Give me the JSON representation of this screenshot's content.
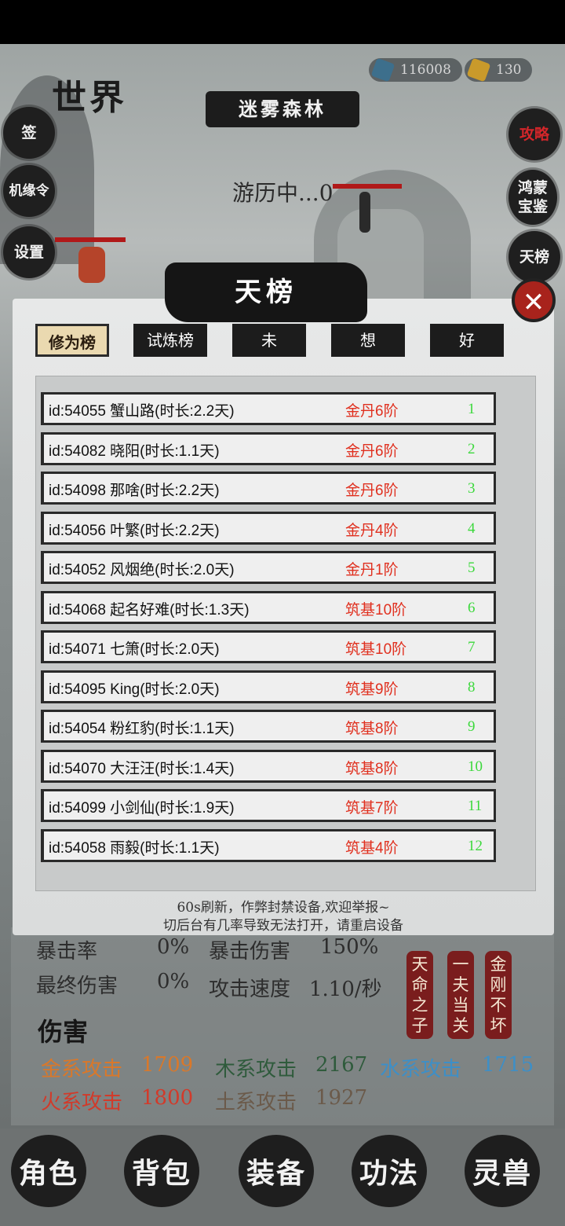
{
  "header": {
    "world_title": "世界",
    "location": "迷雾森林",
    "status": "游历中...0"
  },
  "resources": {
    "crystal": "116008",
    "gold": "130"
  },
  "left_buttons": [
    "签",
    "机缘令",
    "设置"
  ],
  "right_buttons": [
    "攻略",
    "鸿蒙宝鉴",
    "天榜"
  ],
  "panel": {
    "title": "天榜",
    "close": "✕",
    "tabs": [
      "修为榜",
      "试炼榜",
      "未",
      "想",
      "好"
    ],
    "active_tab": 0,
    "rows": [
      {
        "name": "id:54055 蟹山路(时长:2.2天)",
        "level": "金丹6阶",
        "rank": "1"
      },
      {
        "name": "id:54082 晓阳(时长:1.1天)",
        "level": "金丹6阶",
        "rank": "2"
      },
      {
        "name": "id:54098 那啥(时长:2.2天)",
        "level": "金丹6阶",
        "rank": "3"
      },
      {
        "name": "id:54056 叶繁(时长:2.2天)",
        "level": "金丹4阶",
        "rank": "4"
      },
      {
        "name": "id:54052 风烟绝(时长:2.0天)",
        "level": "金丹1阶",
        "rank": "5"
      },
      {
        "name": "id:54068 起名好难(时长:1.3天)",
        "level": "筑基10阶",
        "rank": "6"
      },
      {
        "name": "id:54071 七箫(时长:2.0天)",
        "level": "筑基10阶",
        "rank": "7"
      },
      {
        "name": "id:54095 King(时长:2.0天)",
        "level": "筑基9阶",
        "rank": "8"
      },
      {
        "name": "id:54054 粉红豹(时长:1.1天)",
        "level": "筑基8阶",
        "rank": "9"
      },
      {
        "name": "id:54070 大汪汪(时长:1.4天)",
        "level": "筑基8阶",
        "rank": "10"
      },
      {
        "name": "id:54099 小剑仙(时长:1.9天)",
        "level": "筑基7阶",
        "rank": "11"
      },
      {
        "name": "id:54058 雨毅(时长:1.1天)",
        "level": "筑基4阶",
        "rank": "12"
      }
    ],
    "notice_line1": "60s刷新，作弊封禁设备,欢迎举报~",
    "notice_line2": "切后台有几率导致无法打开，请重启设备"
  },
  "stats": {
    "crit_rate_label": "暴击率",
    "crit_rate": "0%",
    "crit_dmg_label": "暴击伤害",
    "crit_dmg": "150%",
    "final_dmg_label": "最终伤害",
    "final_dmg": "0%",
    "atk_speed_label": "攻击速度",
    "atk_speed": "1.10/秒",
    "damage_title": "伤害",
    "metal_label": "金系攻击",
    "metal": "1709",
    "wood_label": "木系攻击",
    "wood": "2167",
    "water_label": "水系攻击",
    "water": "1715",
    "fire_label": "火系攻击",
    "fire": "1800",
    "earth_label": "土系攻击",
    "earth": "1927"
  },
  "talents": [
    "天命之子",
    "一夫当关",
    "金刚不坏"
  ],
  "bottom_nav": [
    "角色",
    "背包",
    "装备",
    "功法",
    "灵兽"
  ],
  "colors": {
    "metal": "#d9782a",
    "wood": "#2f5b3c",
    "water": "#3d8fc7",
    "fire": "#d23a2a",
    "earth": "#6b5a4a",
    "rank": "#3cd83c",
    "level": "#e0301f"
  }
}
